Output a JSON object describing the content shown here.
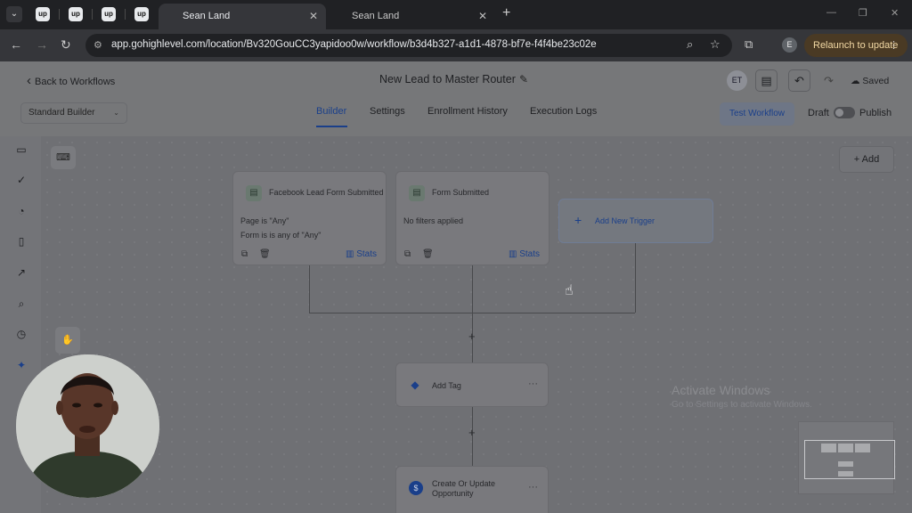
{
  "browser": {
    "tabs": [
      {
        "title": "Sean Land",
        "active": true
      },
      {
        "title": "Sean Land",
        "active": false
      }
    ],
    "pinned_tabs": [
      "up",
      "up",
      "up",
      "up"
    ],
    "url": "app.gohighlevel.com/location/Bv320GouCC3yapidoo0w/workflow/b3d4b327-a1d1-4878-bf7e-f4f4be23c02e",
    "relaunch_label": "Relaunch to update",
    "profile_initial": "E"
  },
  "header": {
    "back_label": "Back to Workflows",
    "workflow_title": "New Lead to Master Router",
    "avatar_initials": "ET",
    "saved_label": "Saved",
    "builder_select": "Standard Builder",
    "tabs": [
      "Builder",
      "Settings",
      "Enrollment History",
      "Execution Logs"
    ],
    "test_label": "Test Workflow",
    "draft_label": "Draft",
    "publish_label": "Publish"
  },
  "canvas": {
    "add_label": "Add",
    "triggers": [
      {
        "title": "Facebook Lead Form Submitted",
        "lines": [
          "Page is \"Any\"",
          "Form is is any of \"Any\""
        ],
        "stats_label": "Stats"
      },
      {
        "title": "Form Submitted",
        "lines": [
          "No filters applied"
        ],
        "stats_label": "Stats"
      }
    ],
    "add_trigger_label": "Add New Trigger",
    "actions": [
      {
        "label": "Add Tag"
      },
      {
        "label": "Create Or Update Opportunity"
      }
    ],
    "watermark_title": "Activate Windows",
    "watermark_sub": "Go to Settings to activate Windows."
  },
  "colors": {
    "accent": "#1a3f8a",
    "overlay_bg": "#737478"
  }
}
